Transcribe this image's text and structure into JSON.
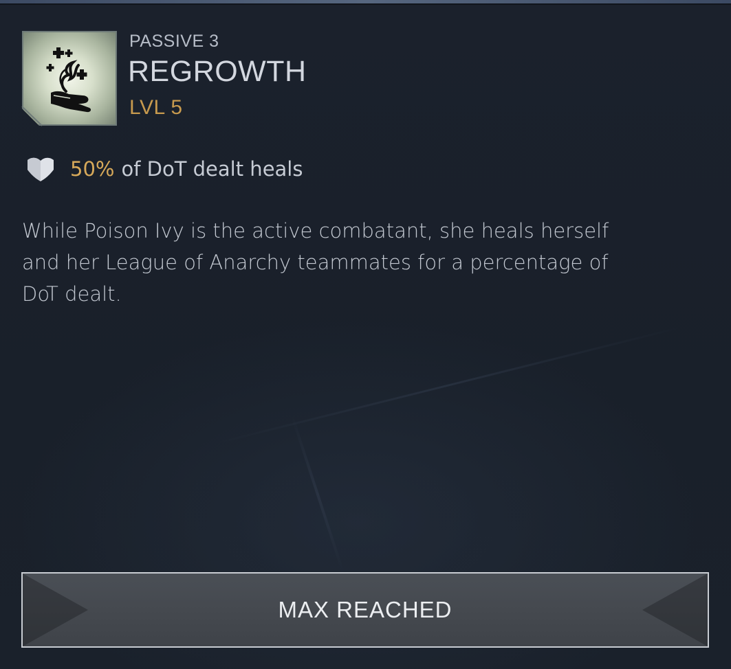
{
  "skill": {
    "slot_label": "PASSIVE 3",
    "name": "REGROWTH",
    "level": "LVL 5",
    "icon": "hand-with-healing-crosses-icon"
  },
  "stat": {
    "icon": "heart-shield-icon",
    "value": "50%",
    "text": "of DoT dealt heals"
  },
  "description": "While Poison Ivy is the active combatant, she heals herself and her League of Anarchy teammates for a percentage of DoT dealt.",
  "action_button": {
    "label": "MAX REACHED"
  },
  "colors": {
    "accent_gold": "#c79a4e",
    "background": "#1a202b",
    "button_fill": "#45494f"
  }
}
